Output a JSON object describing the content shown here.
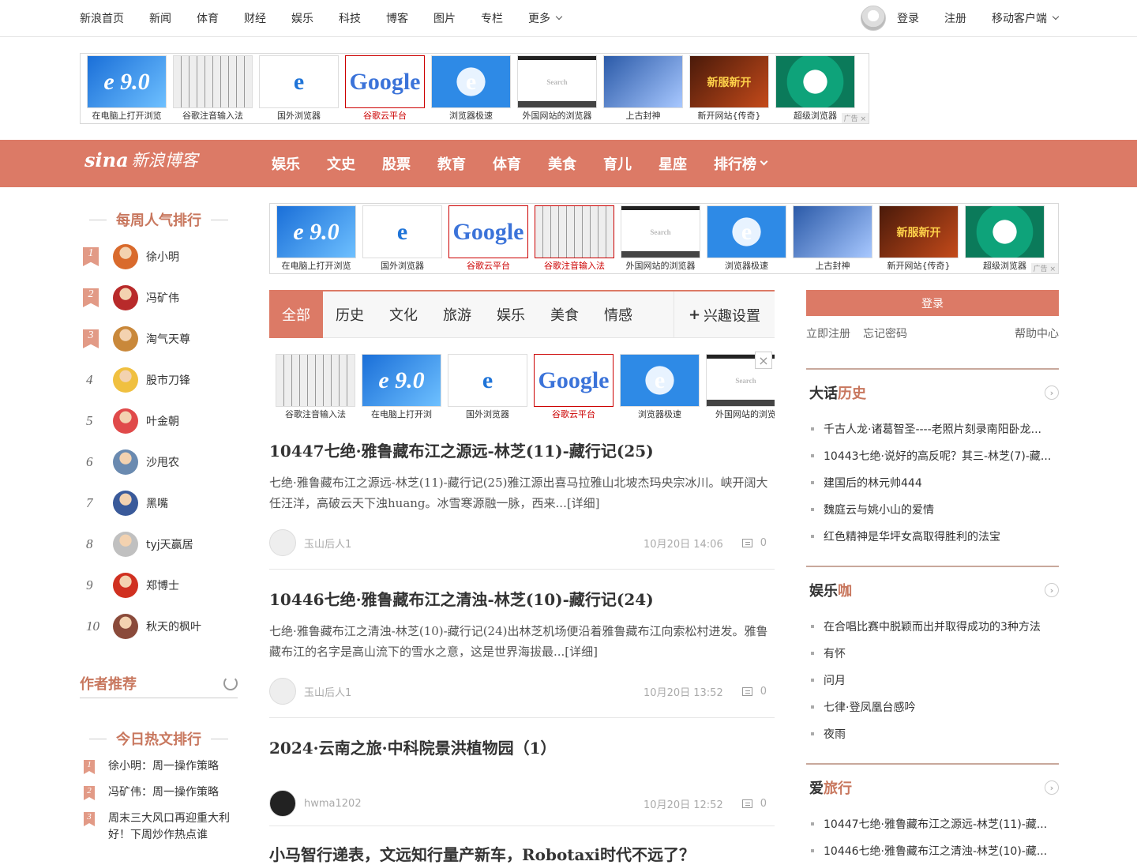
{
  "topnav": {
    "items": [
      "新浪首页",
      "新闻",
      "体育",
      "财经",
      "娱乐",
      "科技",
      "博客",
      "图片",
      "专栏"
    ],
    "more": "更多",
    "login": "登录",
    "register": "注册",
    "client": "移动客户端"
  },
  "ad_top": [
    {
      "cap": "在电脑上打开浏览",
      "img": "e 9.0"
    },
    {
      "cap": "谷歌注音输入法",
      "img": ""
    },
    {
      "cap": "国外浏览器",
      "img": "e"
    },
    {
      "cap": "谷歌云平台",
      "img": "Google"
    },
    {
      "cap": "浏览器极速",
      "img": "e"
    },
    {
      "cap": "外国网站的浏览器",
      "img": "Search"
    },
    {
      "cap": "上古封神",
      "img": ""
    },
    {
      "cap": "新开网站{传奇}",
      "img": "新服新开"
    },
    {
      "cap": "超级浏览器",
      "img": "e"
    }
  ],
  "ad_tag": "广告",
  "bloglogo": {
    "brand": "sina",
    "text": "新浪博客"
  },
  "rednav": {
    "items": [
      "娱乐",
      "文史",
      "股票",
      "教育",
      "体育",
      "美食",
      "育儿",
      "星座"
    ],
    "more": "排行榜"
  },
  "ad_mid": [
    {
      "cap": "在电脑上打开浏览",
      "img": "e 9.0"
    },
    {
      "cap": "国外浏览器",
      "img": "e"
    },
    {
      "cap": "谷歌云平台",
      "img": "Google"
    },
    {
      "cap": "谷歌注音输入法",
      "img": ""
    },
    {
      "cap": "外国网站的浏览器",
      "img": "Search"
    },
    {
      "cap": "浏览器极速",
      "img": "e"
    },
    {
      "cap": "上古封神",
      "img": ""
    },
    {
      "cap": "新开网站{传奇}",
      "img": "新服新开"
    },
    {
      "cap": "超级浏览器",
      "img": "e"
    }
  ],
  "ad_inner": [
    {
      "cap": "谷歌注音输入法",
      "img": ""
    },
    {
      "cap": "在电脑上打开浏",
      "img": "e 9.0"
    },
    {
      "cap": "国外浏览器",
      "img": "e"
    },
    {
      "cap": "谷歌云平台",
      "img": "Google"
    },
    {
      "cap": "浏览器极速",
      "img": "e"
    },
    {
      "cap": "外国网站的浏览",
      "img": "Search"
    }
  ],
  "weekly": {
    "title": "每周人气排行",
    "items": [
      {
        "n": "1",
        "name": "徐小明"
      },
      {
        "n": "2",
        "name": "冯矿伟"
      },
      {
        "n": "3",
        "name": "淘气天尊"
      },
      {
        "n": "4",
        "name": "股市刀锋"
      },
      {
        "n": "5",
        "name": "叶金朝"
      },
      {
        "n": "6",
        "name": "沙甩农"
      },
      {
        "n": "7",
        "name": "黑嘴"
      },
      {
        "n": "8",
        "name": "tyj天赢居"
      },
      {
        "n": "9",
        "name": "郑博士"
      },
      {
        "n": "10",
        "name": "秋天的枫叶"
      }
    ]
  },
  "author_rec": "作者推荐",
  "hot": {
    "title": "今日热文排行",
    "items": [
      {
        "n": "1",
        "text": "徐小明：周一操作策略"
      },
      {
        "n": "2",
        "text": "冯矿伟：周一操作策略"
      },
      {
        "n": "3",
        "text": "周末三大风口再迎重大利好！下周炒作热点谁"
      }
    ]
  },
  "tabs": {
    "items": [
      "全部",
      "历史",
      "文化",
      "旅游",
      "娱乐",
      "美食",
      "情感"
    ],
    "interest": "兴趣设置"
  },
  "articles": [
    {
      "title": "10447七绝·雅鲁藏布江之源远-林芝(11)-藏行记(25)",
      "summary": "七绝·雅鲁藏布江之源远-林芝(11)-藏行记(25)雅江源出喜马拉雅山北坡杰玛央宗冰川。峡开阔大任汪洋，高破云天下浊huang。冰雪寒源融一脉，西来...[详细]",
      "author": "玉山后人1",
      "time": "10月20日 14:06",
      "comments": "0"
    },
    {
      "title": "10446七绝·雅鲁藏布江之清浊-林芝(10)-藏行记(24)",
      "summary": "七绝·雅鲁藏布江之清浊-林芝(10)-藏行记(24)出林芝机场便沿着雅鲁藏布江向索松村进发。雅鲁藏布江的名字是高山流下的雪水之意，这是世界海拔最...[详细]",
      "author": "玉山后人1",
      "time": "10月20日 13:52",
      "comments": "0"
    },
    {
      "title": "2024·云南之旅·中科院景洪植物园（1）",
      "summary": "",
      "author": "hwma1202",
      "time": "10月20日 12:52",
      "comments": "0"
    },
    {
      "title": "小马智行递表，文远知行量产新车，Robotaxi时代不远了？",
      "summary": "",
      "author": "",
      "time": "",
      "comments": ""
    }
  ],
  "login": {
    "button": "登录",
    "register": "立即注册",
    "forgot": "忘记密码",
    "help": "帮助中心"
  },
  "right_sections": [
    {
      "a": "大话",
      "b": "历史",
      "items": [
        "千古人龙·诸葛智圣----老照片刻录南阳卧龙...",
        "10443七绝·说好的高反呢？其三-林芝(7)-藏...",
        "建国后的林元帅444",
        "魏庭云与姚小山的爱情",
        "红色精神是华坪女高取得胜利的法宝"
      ]
    },
    {
      "a": "娱乐",
      "b": "咖",
      "items": [
        "在合唱比赛中脱颖而出并取得成功的3种方法",
        "有怀",
        "问月",
        "七律·登凤凰台感吟",
        "夜雨"
      ]
    },
    {
      "a": "爱",
      "b": "旅行",
      "items": [
        "10447七绝·雅鲁藏布江之源远-林芝(11)-藏...",
        "10446七绝·雅鲁藏布江之清浊-林芝(10)-藏..."
      ]
    }
  ],
  "colors": {
    "brand": "#dc7a66",
    "accent": "#c8775e"
  }
}
